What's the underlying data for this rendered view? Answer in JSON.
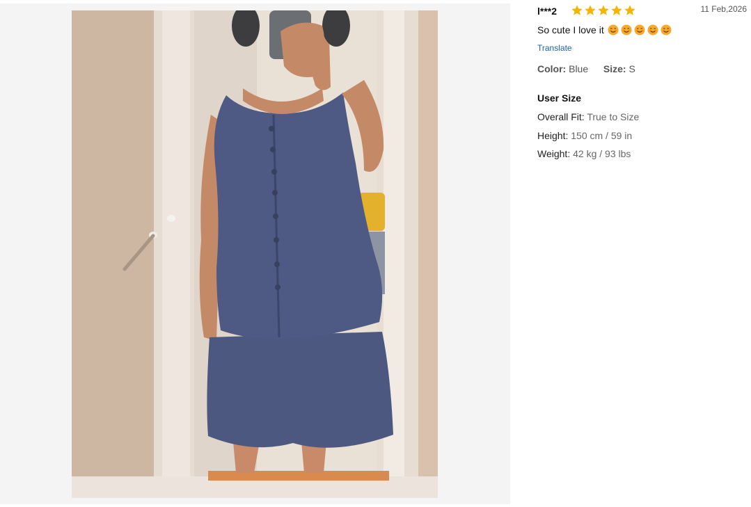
{
  "review": {
    "reviewer": "l***2",
    "rating": 5,
    "date": "11 Feb,2026",
    "text": "So cute I love it",
    "emoji_count": 5,
    "translate_label": "Translate",
    "color_label": "Color:",
    "color_value": "Blue",
    "size_label": "Size:",
    "size_value": "S"
  },
  "user_size": {
    "title": "User Size",
    "fit_label": "Overall Fit:",
    "fit_value": "True to Size",
    "height_label": "Height:",
    "height_value": "150 cm / 59 in",
    "weight_label": "Weight:",
    "weight_value": "42 kg / 93 lbs"
  },
  "colors": {
    "star": "#f5b400",
    "link": "#1a5fb4",
    "outfit": "#4c5880"
  }
}
